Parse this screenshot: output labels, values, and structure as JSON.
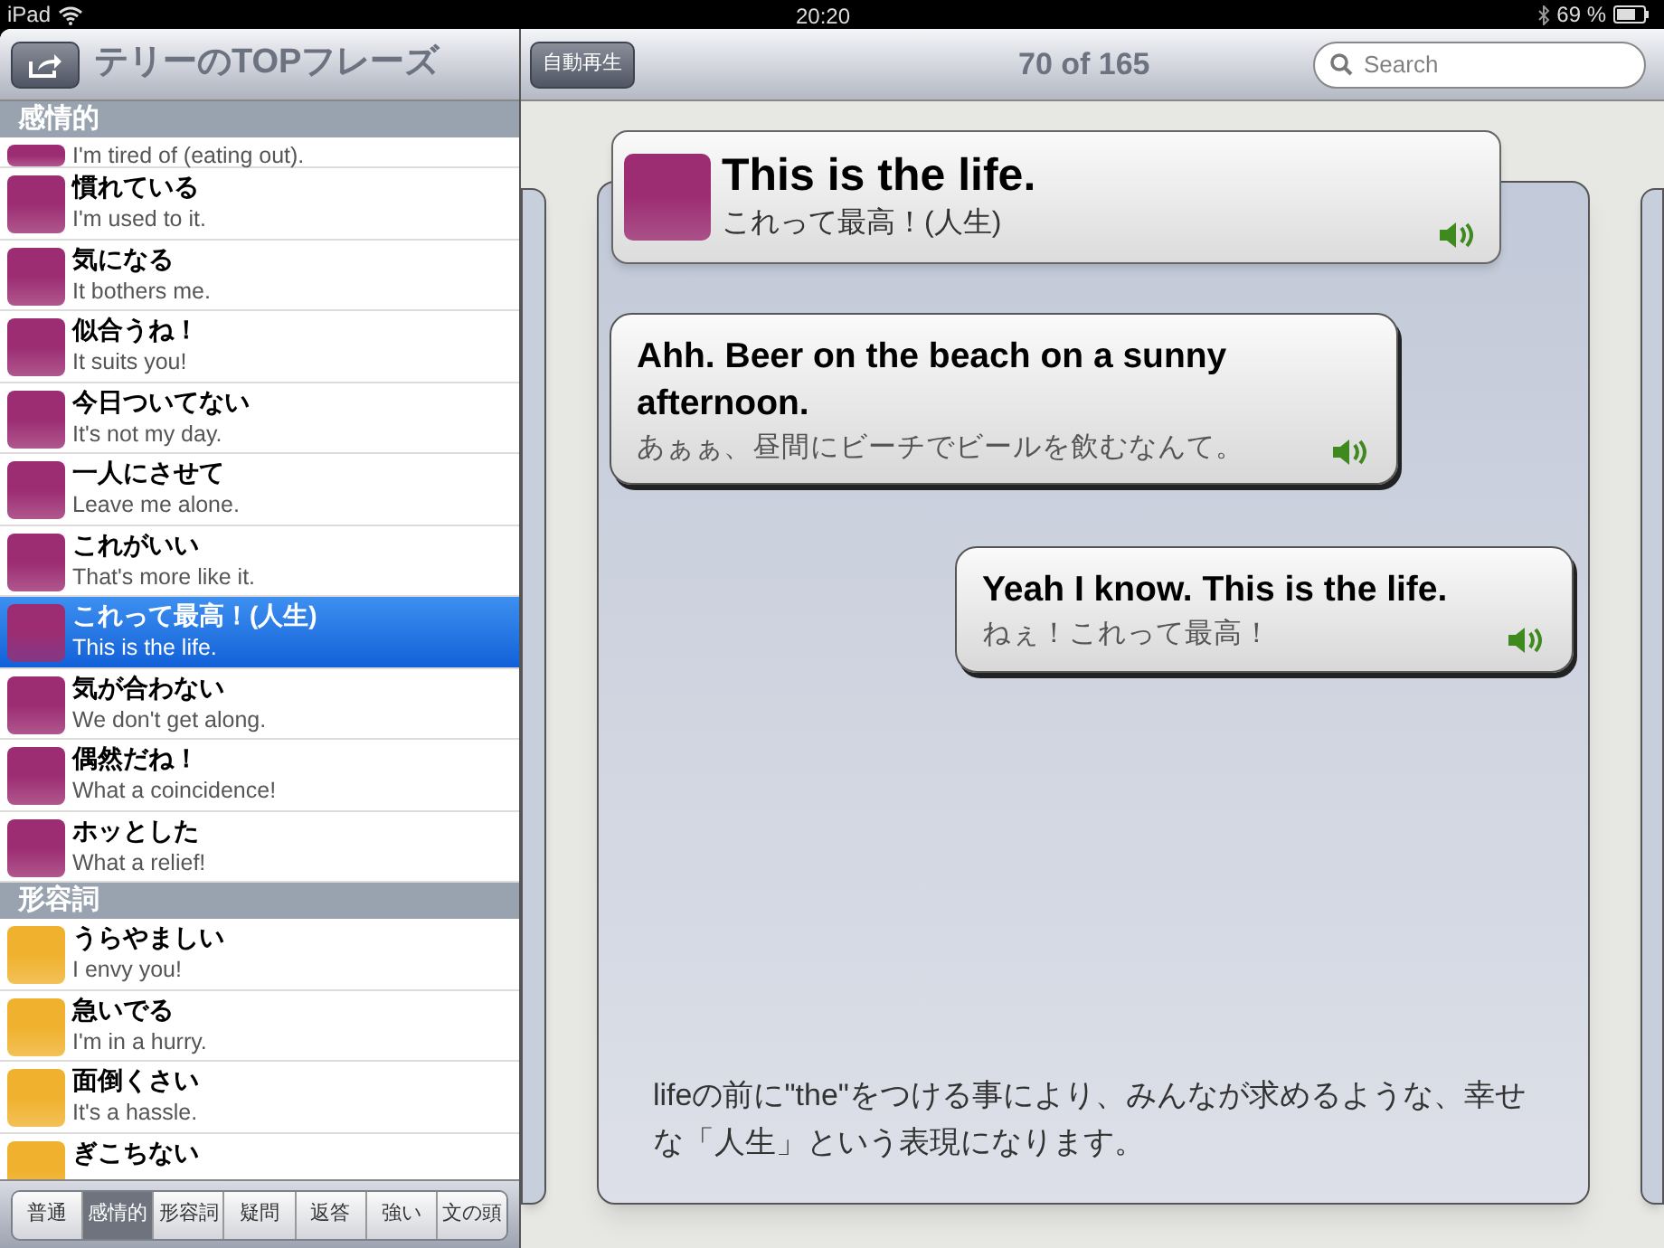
{
  "status_bar": {
    "device": "iPad",
    "time": "20:20",
    "battery": "69 %"
  },
  "sidebar": {
    "title": "テリーのTOPフレーズ",
    "sections": [
      {
        "label": "感情的",
        "color": "#9c2d72",
        "rows": [
          {
            "en": "I'm tired of (eating out).",
            "selected": false
          },
          {
            "jp": "慣れている",
            "en": "I'm used to it.",
            "selected": false
          },
          {
            "jp": "気になる",
            "en": "It bothers me.",
            "selected": false
          },
          {
            "jp": "似合うね！",
            "en": "It suits you!",
            "selected": false
          },
          {
            "jp": "今日ついてない",
            "en": "It's not my day.",
            "selected": false
          },
          {
            "jp": "一人にさせて",
            "en": "Leave me alone.",
            "selected": false
          },
          {
            "jp": "これがいい",
            "en": "That's more like it.",
            "selected": false
          },
          {
            "jp": "これって最高！(人生)",
            "en": "This is the life.",
            "selected": true
          },
          {
            "jp": "気が合わない",
            "en": "We don't get along.",
            "selected": false
          },
          {
            "jp": "偶然だね！",
            "en": "What a coincidence!",
            "selected": false
          },
          {
            "jp": "ホッとした",
            "en": "What a relief!",
            "selected": false
          }
        ]
      },
      {
        "label": "形容詞",
        "color": "#f0b22e",
        "rows": [
          {
            "jp": "うらやましい",
            "en": "I envy you!",
            "selected": false
          },
          {
            "jp": "急いでる",
            "en": "I'm in a hurry.",
            "selected": false
          },
          {
            "jp": "面倒くさい",
            "en": "It's a hassle.",
            "selected": false
          },
          {
            "jp": "ぎこちない",
            "selected": false
          }
        ]
      }
    ],
    "tabs": [
      {
        "label": "普通",
        "selected": false
      },
      {
        "label": "感情的",
        "selected": true
      },
      {
        "label": "形容詞",
        "selected": false
      },
      {
        "label": "疑問",
        "selected": false
      },
      {
        "label": "返答",
        "selected": false
      },
      {
        "label": "強い",
        "selected": false
      },
      {
        "label": "文の頭",
        "selected": false
      }
    ]
  },
  "toolbar": {
    "autoplay": "自動再生",
    "counter": "70 of 165",
    "search": {
      "placeholder": "Search"
    }
  },
  "card": {
    "title": "This is the life.",
    "subtitle": "これって最高！(人生)",
    "color": "#9c2d72",
    "dialogue": [
      {
        "kind": "left",
        "en": "Ahh. Beer on the beach on a sunny afternoon.",
        "jp": "あぁぁ、昼間にビーチでビールを飲むなんて。"
      },
      {
        "kind": "right",
        "en": "Yeah I know. This is the life.",
        "jp": "ねぇ！これって最高！"
      }
    ],
    "note": "lifeの前に\"the\"をつける事により、みんなが求めるような、幸せな「人生」という表現になります。"
  }
}
